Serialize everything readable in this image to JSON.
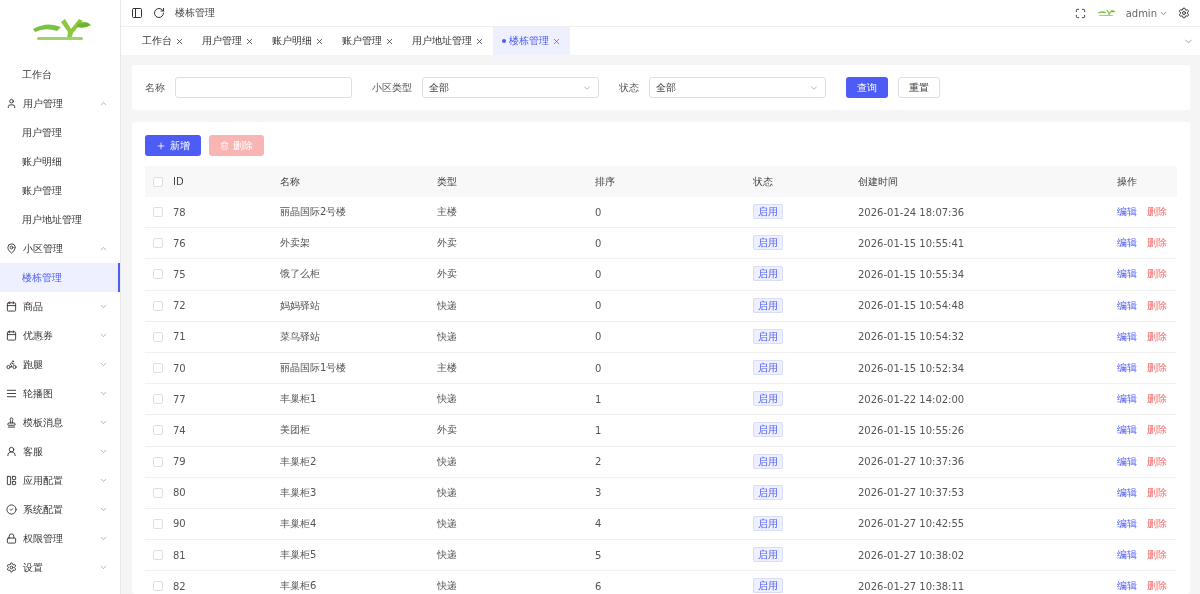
{
  "header": {
    "breadcrumb": "楼栋管理",
    "user": "admin"
  },
  "sidebar": {
    "items": [
      {
        "label": "工作台",
        "kind": "leaf",
        "selected": false
      },
      {
        "label": "用户管理",
        "kind": "group",
        "expanded": true,
        "children": [
          {
            "label": "用户管理",
            "selected": false
          },
          {
            "label": "账户明细",
            "selected": false
          },
          {
            "label": "账户管理",
            "selected": false
          },
          {
            "label": "用户地址管理",
            "selected": false
          }
        ]
      },
      {
        "label": "小区管理",
        "kind": "group",
        "expanded": true,
        "children": [
          {
            "label": "楼栋管理",
            "selected": true
          }
        ]
      },
      {
        "label": "商品",
        "kind": "group",
        "expanded": false
      },
      {
        "label": "优惠券",
        "kind": "group",
        "expanded": false
      },
      {
        "label": "跑腿",
        "kind": "group",
        "expanded": false
      },
      {
        "label": "轮播图",
        "kind": "group",
        "expanded": false
      },
      {
        "label": "模板消息",
        "kind": "group",
        "expanded": false
      },
      {
        "label": "客服",
        "kind": "group",
        "expanded": false
      },
      {
        "label": "应用配置",
        "kind": "group",
        "expanded": false
      },
      {
        "label": "系统配置",
        "kind": "group",
        "expanded": false
      },
      {
        "label": "权限管理",
        "kind": "group",
        "expanded": false
      },
      {
        "label": "设置",
        "kind": "group",
        "expanded": false
      }
    ]
  },
  "tabs": [
    {
      "label": "工作台",
      "selected": false
    },
    {
      "label": "用户管理",
      "selected": false
    },
    {
      "label": "账户明细",
      "selected": false
    },
    {
      "label": "账户管理",
      "selected": false
    },
    {
      "label": "用户地址管理",
      "selected": false
    },
    {
      "label": "楼栋管理",
      "selected": true
    }
  ],
  "filters": [
    {
      "label": "名称",
      "kind": "input"
    },
    {
      "label": "小区类型",
      "kind": "select",
      "value": "全部"
    },
    {
      "label": "状态",
      "kind": "select",
      "value": "全部"
    }
  ],
  "filter_buttons": [
    {
      "label": "查询",
      "kind": "primary"
    },
    {
      "label": "重置",
      "kind": "default"
    }
  ],
  "actions": [
    {
      "label": "新增",
      "kind": "add",
      "disabled": false
    },
    {
      "label": "删除",
      "kind": "delete",
      "disabled": true
    }
  ],
  "table": {
    "header_checked": false,
    "columns": [
      "ID",
      "名称",
      "类型",
      "排序",
      "状态",
      "创建时间",
      "操作"
    ],
    "rows": [
      {
        "checked": false,
        "id": "78",
        "name": "丽晶国际2号楼",
        "type": "主楼",
        "sort": "0",
        "status": "启用",
        "created": "2026-01-24 18:07:36",
        "edit": "编辑",
        "delete": "删除"
      },
      {
        "checked": false,
        "id": "76",
        "name": "外卖架",
        "type": "外卖",
        "sort": "0",
        "status": "启用",
        "created": "2026-01-15 10:55:41",
        "edit": "编辑",
        "delete": "删除"
      },
      {
        "checked": false,
        "id": "75",
        "name": "饿了么柜",
        "type": "外卖",
        "sort": "0",
        "status": "启用",
        "created": "2026-01-15 10:55:34",
        "edit": "编辑",
        "delete": "删除"
      },
      {
        "checked": false,
        "id": "72",
        "name": "妈妈驿站",
        "type": "快递",
        "sort": "0",
        "status": "启用",
        "created": "2026-01-15 10:54:48",
        "edit": "编辑",
        "delete": "删除"
      },
      {
        "checked": false,
        "id": "71",
        "name": "菜鸟驿站",
        "type": "快递",
        "sort": "0",
        "status": "启用",
        "created": "2026-01-15 10:54:32",
        "edit": "编辑",
        "delete": "删除"
      },
      {
        "checked": false,
        "id": "70",
        "name": "丽晶国际1号楼",
        "type": "主楼",
        "sort": "0",
        "status": "启用",
        "created": "2026-01-15 10:52:34",
        "edit": "编辑",
        "delete": "删除"
      },
      {
        "checked": false,
        "id": "77",
        "name": "丰巢柜1",
        "type": "快递",
        "sort": "1",
        "status": "启用",
        "created": "2026-01-22 14:02:00",
        "edit": "编辑",
        "delete": "删除"
      },
      {
        "checked": false,
        "id": "74",
        "name": "美团柜",
        "type": "外卖",
        "sort": "1",
        "status": "启用",
        "created": "2026-01-15 10:55:26",
        "edit": "编辑",
        "delete": "删除"
      },
      {
        "checked": false,
        "id": "79",
        "name": "丰巢柜2",
        "type": "快递",
        "sort": "2",
        "status": "启用",
        "created": "2026-01-27 10:37:36",
        "edit": "编辑",
        "delete": "删除"
      },
      {
        "checked": false,
        "id": "80",
        "name": "丰巢柜3",
        "type": "快递",
        "sort": "3",
        "status": "启用",
        "created": "2026-01-27 10:37:53",
        "edit": "编辑",
        "delete": "删除"
      },
      {
        "checked": false,
        "id": "90",
        "name": "丰巢柜4",
        "type": "快递",
        "sort": "4",
        "status": "启用",
        "created": "2026-01-27 10:42:55",
        "edit": "编辑",
        "delete": "删除"
      },
      {
        "checked": false,
        "id": "81",
        "name": "丰巢柜5",
        "type": "快递",
        "sort": "5",
        "status": "启用",
        "created": "2026-01-27 10:38:02",
        "edit": "编辑",
        "delete": "删除"
      },
      {
        "checked": false,
        "id": "82",
        "name": "丰巢柜6",
        "type": "快递",
        "sort": "6",
        "status": "启用",
        "created": "2026-01-27 10:38:11",
        "edit": "编辑",
        "delete": "删除"
      }
    ]
  }
}
